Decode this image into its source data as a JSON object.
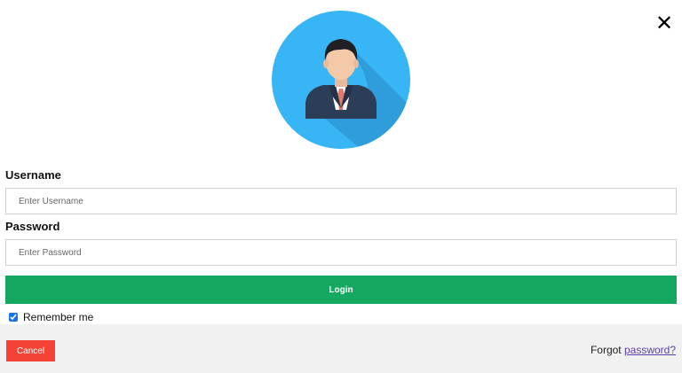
{
  "close": {
    "icon": "close-icon",
    "glyph": "✕"
  },
  "avatar": {
    "icon": "user-avatar-icon",
    "bg_color": "#37b5f4"
  },
  "form": {
    "username_label": "Username",
    "username_placeholder": "Enter Username",
    "username_value": "",
    "password_label": "Password",
    "password_placeholder": "Enter Password",
    "password_value": "",
    "login_label": "Login",
    "remember_label": "Remember me",
    "remember_checked": true
  },
  "footer": {
    "cancel_label": "Cancel",
    "forgot_prefix": "Forgot",
    "forgot_link": "password?"
  },
  "colors": {
    "login": "#15a861",
    "cancel": "#f44336",
    "link": "#5b3fa8",
    "footer_bg": "#f1f1f1"
  }
}
